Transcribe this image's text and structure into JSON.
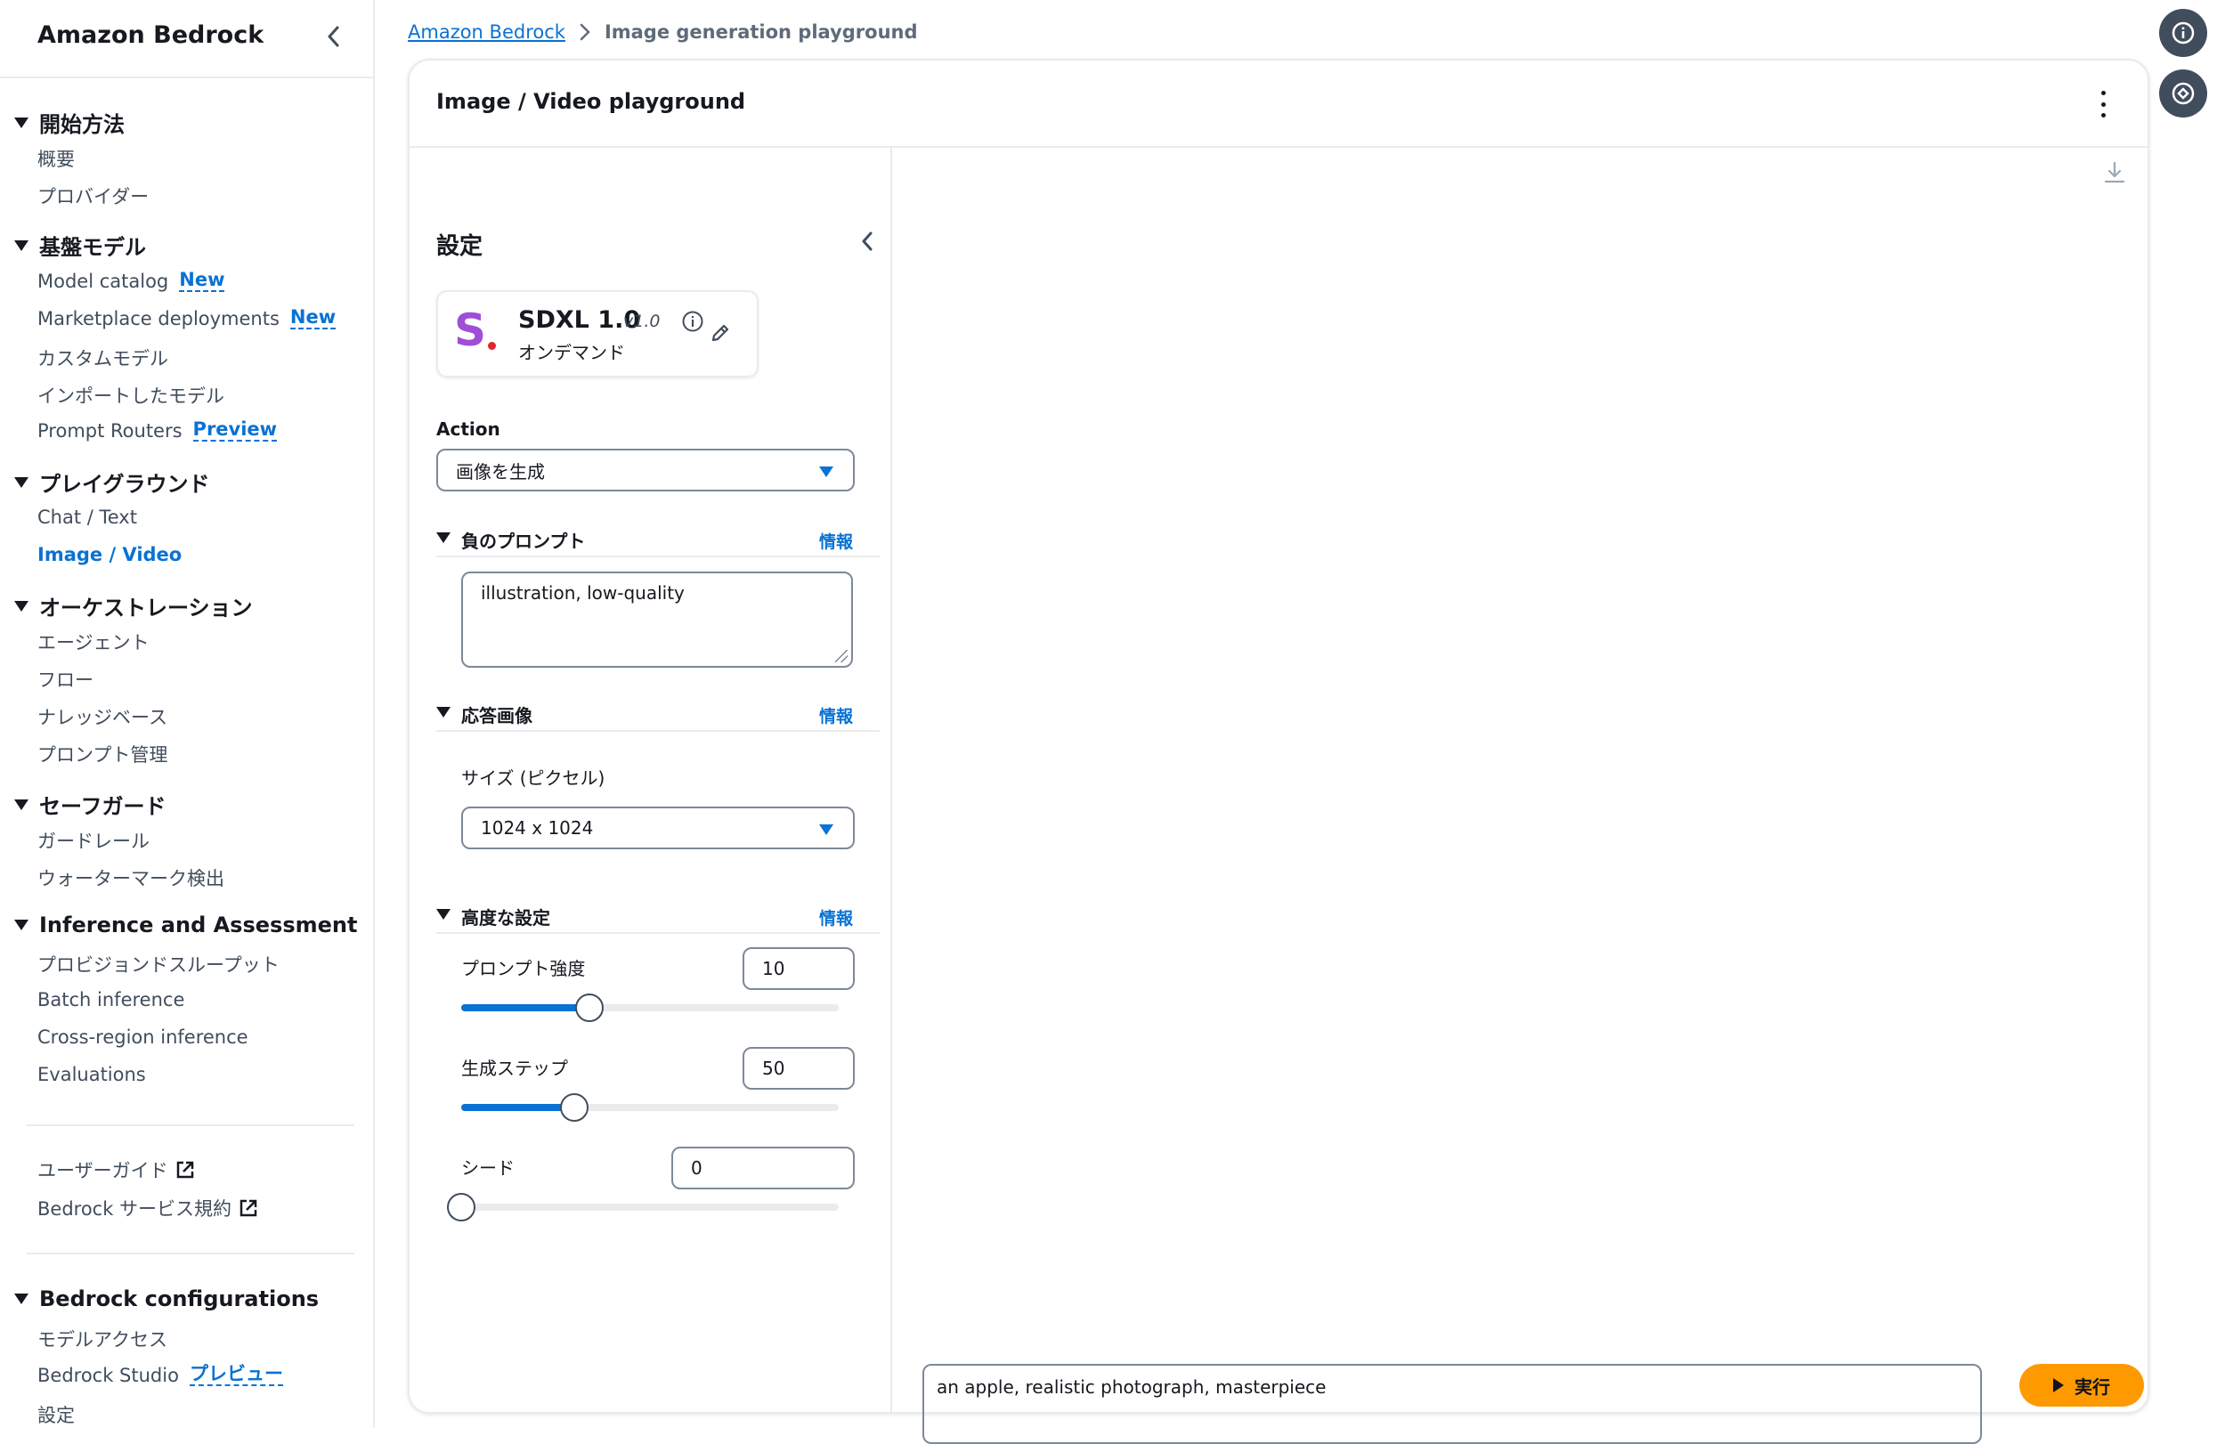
{
  "sidebar": {
    "title": "Amazon Bedrock",
    "sections": [
      {
        "label": "開始方法",
        "items": [
          "概要",
          "プロバイダー"
        ]
      },
      {
        "label": "基盤モデル",
        "items": [
          "Model catalog",
          "Marketplace deployments",
          "カスタムモデル",
          "インポートしたモデル",
          "Prompt Routers"
        ]
      },
      {
        "label": "プレイグラウンド",
        "items": [
          "Chat / Text",
          "Image / Video"
        ]
      },
      {
        "label": "オーケストレーション",
        "items": [
          "エージェント",
          "フロー",
          "ナレッジベース",
          "プロンプト管理"
        ]
      },
      {
        "label": "セーフガード",
        "items": [
          "ガードレール",
          "ウォーターマーク検出"
        ]
      },
      {
        "label": "Inference and Assessment",
        "items": [
          "プロビジョンドスループット",
          "Batch inference",
          "Cross-region inference",
          "Evaluations"
        ]
      },
      {
        "label": "Bedrock configurations",
        "items": [
          "モデルアクセス",
          "Bedrock Studio",
          "設定"
        ]
      }
    ],
    "badges": {
      "new": "New",
      "preview": "Preview",
      "preview_ja": "プレビュー"
    },
    "links": [
      "ユーザーガイド",
      "Bedrock サービス規約"
    ],
    "active_item": "Image / Video"
  },
  "breadcrumb": {
    "root": "Amazon Bedrock",
    "current": "Image generation playground"
  },
  "container": {
    "title": "Image / Video playground"
  },
  "settings": {
    "title": "設定",
    "model": {
      "name": "SDXL 1.0",
      "version": "v1.0",
      "mode": "オンデマンド",
      "logo_letter": "S"
    },
    "action": {
      "label": "Action",
      "value": "画像を生成"
    },
    "negative_prompt": {
      "label": "負のプロンプト",
      "info": "情報",
      "value": "illustration, low-quality"
    },
    "response_image": {
      "label": "応答画像",
      "info": "情報",
      "size_label": "サイズ (ピクセル)",
      "size_value": "1024 x 1024"
    },
    "advanced": {
      "label": "高度な設定",
      "info": "情報",
      "prompt_strength": {
        "label": "プロンプト強度",
        "value": "10",
        "fraction": 0.34
      },
      "generation_steps": {
        "label": "生成ステップ",
        "value": "50",
        "fraction": 0.3
      },
      "seed": {
        "label": "シード",
        "value": "0",
        "fraction": 0.0
      }
    }
  },
  "prompt": {
    "value": "an apple, realistic photograph, masterpiece"
  },
  "run_button": {
    "label": "実行"
  },
  "colors": {
    "accent": "#0972d3",
    "run": "#ff9900",
    "logo": "#a04ed8",
    "text": "#16191f"
  }
}
